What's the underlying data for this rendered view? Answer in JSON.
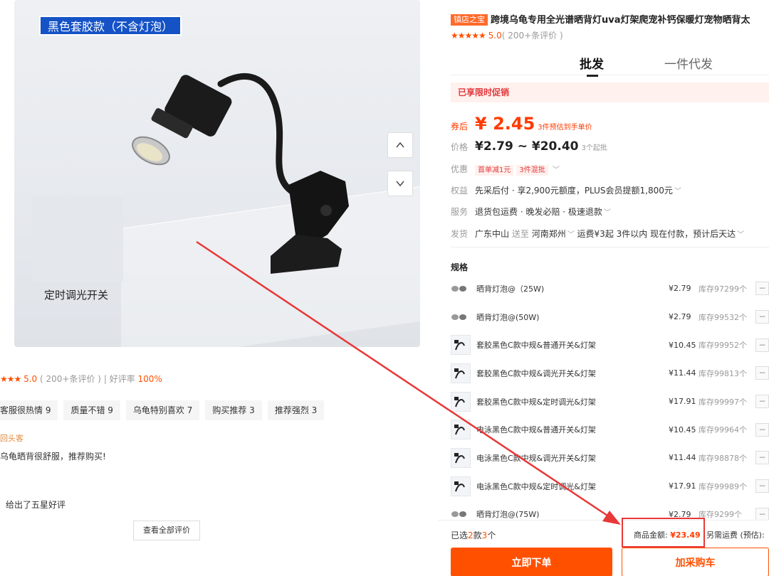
{
  "image": {
    "badge": "黑色套胶款（不含灯泡）",
    "thumb_label": "定时调光开关"
  },
  "review_summary": {
    "stars": "★★★",
    "score": "5.0",
    "count": "( 200+条评价 )",
    "sep": "|",
    "good_rate_label": "好评率",
    "good_rate": "100%",
    "tags": [
      "客服很热情 9",
      "质量不错 9",
      "乌龟特别喜欢 7",
      "购买推荐 3",
      "推荐强烈 3"
    ],
    "reviewer": "回头客",
    "review_text": "乌龟晒背很舒服，推荐购买!",
    "footer": "给出了五星好评",
    "view_all": "查看全部评价"
  },
  "product": {
    "shop_badge": "镇店之宝",
    "title": "跨境乌龟专用全光谱晒背灯uva灯架爬宠补钙保暖灯宠物晒背太",
    "stars": "★★★★★",
    "score": "5.0",
    "review_count": "( 200+条评价 )"
  },
  "tabs": {
    "wholesale": "批发",
    "dropship": "一件代发"
  },
  "promo": "已享限时促销",
  "price": {
    "label": "券后",
    "value": "¥ 2.45",
    "note": "3件预估到手单价",
    "range_label": "价格",
    "range": "¥2.79 ~ ¥20.40",
    "range_note": "3个起批"
  },
  "discount": {
    "label": "优惠",
    "coupons": [
      "首单减1元",
      "3件混批"
    ]
  },
  "rights": {
    "label": "权益",
    "text": "先采后付 · 享2,900元额度，PLUS会员提额1,800元"
  },
  "service": {
    "label": "服务",
    "text": "退货包运费 · 晚发必赔 · 极速退款"
  },
  "shipping_info": {
    "label": "发货",
    "from": "广东中山",
    "to_word": "送至",
    "to": "河南郑州",
    "fee": "运费¥3起",
    "time": "3件以内 现在付款，预计后天达"
  },
  "spec": {
    "title": "规格",
    "items": [
      {
        "name": "晒背灯泡@（25W)",
        "price": "¥2.79",
        "stock": "库存97299个",
        "thumb": "bulb"
      },
      {
        "name": "晒背灯泡@(50W)",
        "price": "¥2.79",
        "stock": "库存99532个",
        "thumb": "bulb"
      },
      {
        "name": "套胶黑色C款中规&普通开关&灯架",
        "price": "¥10.45",
        "stock": "库存99952个",
        "thumb": "lamp"
      },
      {
        "name": "套胶黑色C款中规&调光开关&灯架",
        "price": "¥11.44",
        "stock": "库存99813个",
        "thumb": "lamp"
      },
      {
        "name": "套胶黑色C款中规&定时调光&灯架",
        "price": "¥17.91",
        "stock": "库存99997个",
        "thumb": "lamp"
      },
      {
        "name": "电泳黑色C款中规&普通开关&灯架",
        "price": "¥10.45",
        "stock": "库存99964个",
        "thumb": "lamp"
      },
      {
        "name": "电泳黑色C款中规&调光开关&灯架",
        "price": "¥11.44",
        "stock": "库存98878个",
        "thumb": "lamp"
      },
      {
        "name": "电泳黑色C款中规&定时调光&灯架",
        "price": "¥17.91",
        "stock": "库存99989个",
        "thumb": "lamp"
      },
      {
        "name": "晒背灯泡@(75W)",
        "price": "¥2.79",
        "stock": "库存9299个",
        "thumb": "bulb"
      }
    ],
    "minus": "−"
  },
  "footer": {
    "selected_prefix": "已选",
    "selected_kinds": "2",
    "selected_mid": "款",
    "selected_count": "3",
    "selected_suffix": "个",
    "total_label": "商品金额:",
    "total": "¥23.49",
    "shipping": "另需运费 (预估):",
    "order_button": "立即下单",
    "cart_button": "加采购车"
  },
  "colors": {
    "accent": "#ff5000",
    "annotation": "#e83838",
    "badge_blue": "#1452c6"
  }
}
